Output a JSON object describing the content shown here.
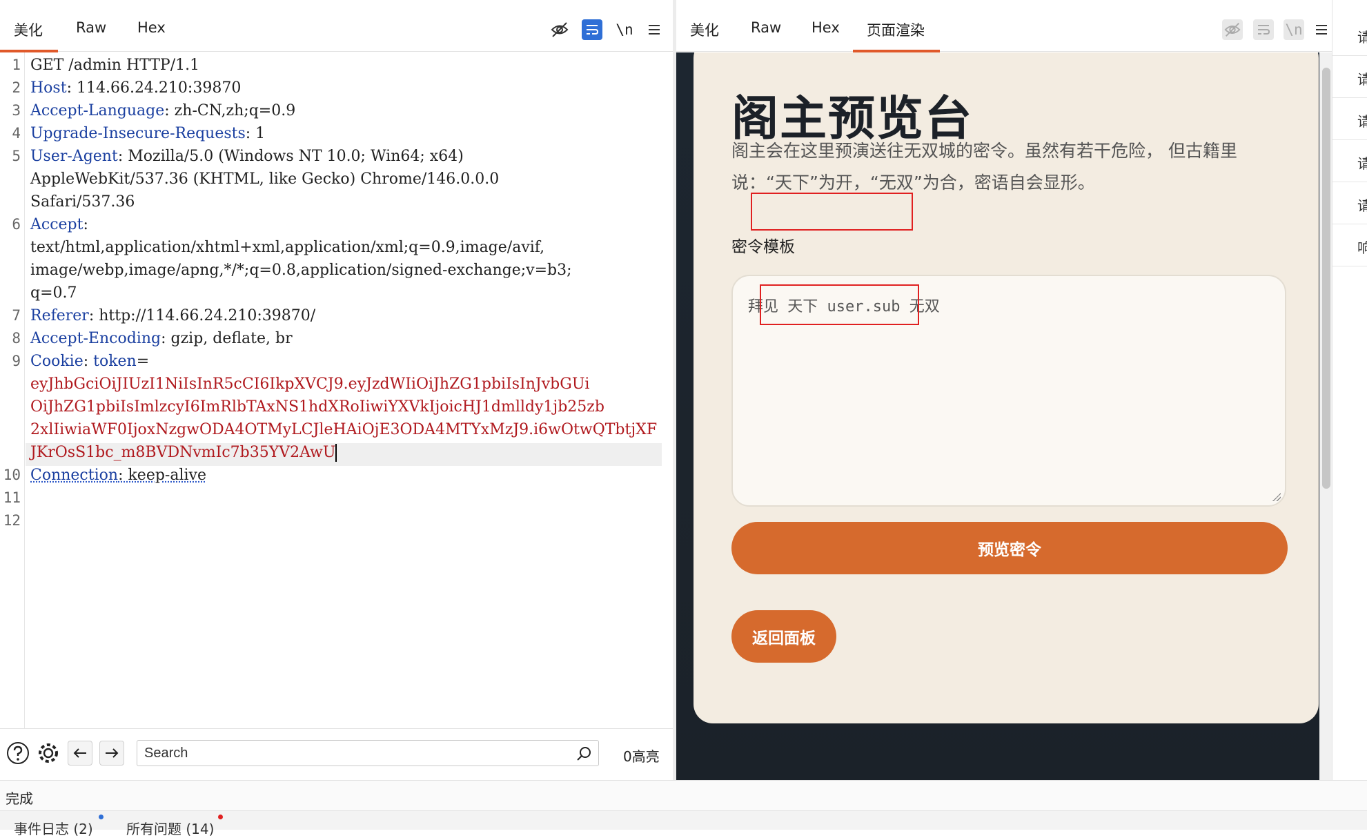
{
  "request": {
    "tabs": [
      "美化",
      "Raw",
      "Hex"
    ],
    "newline_label": "\\n",
    "lines": [
      {
        "num": "1",
        "parts": [
          {
            "t": "GET /admin HTTP/1.1",
            "c": ""
          }
        ]
      },
      {
        "num": "2",
        "parts": [
          {
            "t": "Host",
            "c": "k"
          },
          {
            "t": ": 114.66.24.210:39870",
            "c": ""
          }
        ]
      },
      {
        "num": "3",
        "parts": [
          {
            "t": "Accept-Language",
            "c": "k"
          },
          {
            "t": ": zh-CN,zh;q=0.9",
            "c": ""
          }
        ]
      },
      {
        "num": "4",
        "parts": [
          {
            "t": "Upgrade-Insecure-Requests",
            "c": "k"
          },
          {
            "t": ": 1",
            "c": ""
          }
        ]
      },
      {
        "num": "5",
        "parts": [
          {
            "t": "User-Agent",
            "c": "k"
          },
          {
            "t": ": Mozilla/5.0 (Windows NT 10.0; Win64; x64)",
            "c": ""
          }
        ]
      },
      {
        "num": "",
        "parts": [
          {
            "t": "AppleWebKit/537.36 (KHTML, like Gecko) Chrome/146.0.0.0",
            "c": ""
          }
        ]
      },
      {
        "num": "",
        "parts": [
          {
            "t": "Safari/537.36",
            "c": ""
          }
        ]
      },
      {
        "num": "6",
        "parts": [
          {
            "t": "Accept",
            "c": "k"
          },
          {
            "t": ":",
            "c": ""
          }
        ]
      },
      {
        "num": "",
        "parts": [
          {
            "t": "text/html,application/xhtml+xml,application/xml;q=0.9,image/avif,",
            "c": ""
          }
        ]
      },
      {
        "num": "",
        "parts": [
          {
            "t": "image/webp,image/apng,*/*;q=0.8,application/signed-exchange;v=b3;",
            "c": ""
          }
        ]
      },
      {
        "num": "",
        "parts": [
          {
            "t": "q=0.7",
            "c": ""
          }
        ]
      },
      {
        "num": "7",
        "parts": [
          {
            "t": "Referer",
            "c": "k"
          },
          {
            "t": ": http://114.66.24.210:39870/",
            "c": ""
          }
        ]
      },
      {
        "num": "8",
        "parts": [
          {
            "t": "Accept-Encoding",
            "c": "k"
          },
          {
            "t": ": gzip, deflate, br",
            "c": ""
          }
        ]
      },
      {
        "num": "9",
        "parts": [
          {
            "t": "Cookie",
            "c": "k"
          },
          {
            "t": ": ",
            "c": ""
          },
          {
            "t": "token",
            "c": "k"
          },
          {
            "t": "=",
            "c": ""
          }
        ]
      },
      {
        "num": "",
        "parts": [
          {
            "t": "eyJhbGciOiJIUzI1NiIsInR5cCI6IkpXVCJ9.eyJzdWIiOiJhZG1pbiIsInJvbGUi",
            "c": "cookie-val"
          }
        ]
      },
      {
        "num": "",
        "parts": [
          {
            "t": "OiJhZG1pbiIsImlzcyI6ImRlbTAxNS1hdXRoIiwiYXVkIjoicHJ1dmlldy1jb25zb",
            "c": "cookie-val"
          }
        ]
      },
      {
        "num": "",
        "parts": [
          {
            "t": "2xlIiwiaWF0IjoxNzgwODA4OTMyLCJleHAiOjE3ODA4MTYxMzJ9.i6wOtwQTbtjXF",
            "c": "cookie-val"
          }
        ]
      },
      {
        "num": "",
        "parts": [
          {
            "t": "JKrOsS1bc_m8BVDNvmIc7b35YV2AwU",
            "c": "cookie-val"
          }
        ],
        "caret": true
      },
      {
        "num": "10",
        "parts": [
          {
            "t": "Connection",
            "c": "k dotted"
          },
          {
            "t": ": keep-alive",
            "c": "dotted"
          }
        ]
      },
      {
        "num": "11",
        "parts": []
      },
      {
        "num": "12",
        "parts": []
      }
    ],
    "search": {
      "placeholder": "Search",
      "highlight_count": "0高亮"
    }
  },
  "response": {
    "tabs": [
      "美化",
      "Raw",
      "Hex",
      "页面渲染"
    ],
    "newline_label": "\\n",
    "page": {
      "title": "阁主预览台",
      "desc_line1": "阁主会在这里预演送往无双城的密令。虽然有若干危险， 但古籍里",
      "desc_line2": "说：“天下”为开，“无双”为合，密语自会显形。",
      "template_label": "密令模板",
      "template_value": "拜见 天下 user.sub 无双",
      "preview_button": "预览密令",
      "back_button": "返回面板"
    },
    "side_items": [
      "请",
      "请",
      "请",
      "请",
      "请",
      "响"
    ]
  },
  "status": {
    "text": "完成",
    "bottom_tabs": [
      "事件日志 (2)",
      "所有问题 (14)"
    ]
  },
  "colors": {
    "accent": "#e0592a",
    "button": "#d66a2d",
    "card": "#f3ece1",
    "key": "#1a3fa0",
    "cookie": "#b0191e",
    "annotation": "#e02020"
  }
}
